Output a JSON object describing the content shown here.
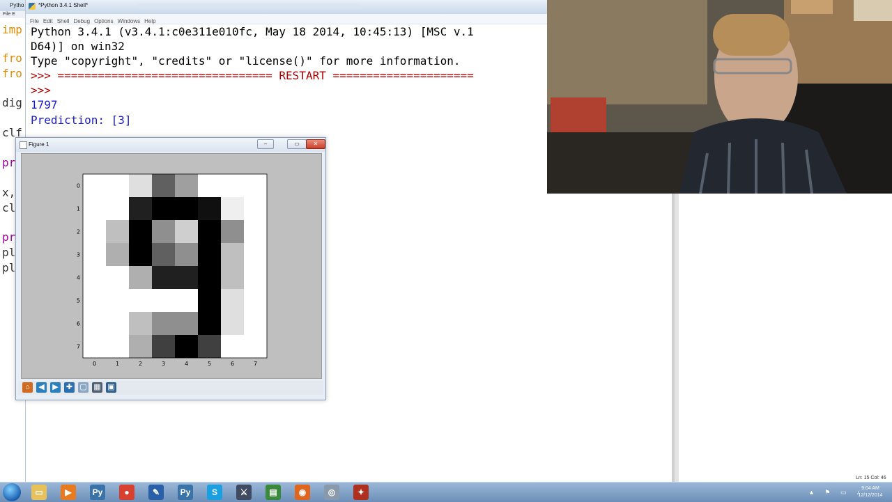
{
  "editor": {
    "title": "Pytho",
    "menu": "File E",
    "lines": [
      {
        "text": "imp",
        "cls": "kw-orange"
      },
      {
        "text": "fro",
        "cls": "kw-orange"
      },
      {
        "text": "fro",
        "cls": "kw-orange"
      },
      {
        "text": "dig",
        "cls": "kw-black"
      },
      {
        "text": "clf",
        "cls": "kw-black"
      },
      {
        "text": "pri",
        "cls": "kw-purple"
      },
      {
        "text": "x,",
        "cls": "kw-black"
      },
      {
        "text": "cl",
        "cls": "kw-black"
      },
      {
        "text": "pri",
        "cls": "kw-purple"
      },
      {
        "text": "pl",
        "cls": "kw-black"
      },
      {
        "text": "pl",
        "cls": "kw-black"
      }
    ]
  },
  "shell": {
    "title": "*Python 3.4.1 Shell*",
    "menu": [
      "File",
      "Edit",
      "Shell",
      "Debug",
      "Options",
      "Windows",
      "Help"
    ],
    "lines": [
      {
        "text": "Python 3.4.1 (v3.4.1:c0e311e010fc, May 18 2014, 10:45:13) [MSC v.1",
        "cls": ""
      },
      {
        "text": "D64)] on win32",
        "cls": ""
      },
      {
        "text": "Type \"copyright\", \"credits\" or \"license()\" for more information.",
        "cls": ""
      },
      {
        "text": ">>> ================================ RESTART =====================",
        "cls": "prompt"
      },
      {
        "text": ">>>",
        "cls": "prompt"
      },
      {
        "text": "1797",
        "cls": "out"
      },
      {
        "text": "Prediction: [3]",
        "cls": "out"
      }
    ],
    "status": "Ln: 15 Col: 46"
  },
  "figure": {
    "title": "Figure 1",
    "buttons": {
      "minimize": "–",
      "maximize": "▭",
      "close": "✕"
    },
    "toolbar": [
      {
        "icon": "home-icon",
        "glyph": "⌂",
        "color": "#d2691e"
      },
      {
        "icon": "back-icon",
        "glyph": "◀",
        "color": "#2a7fbf"
      },
      {
        "icon": "forward-icon",
        "glyph": "▶",
        "color": "#2a7fbf"
      },
      {
        "icon": "pan-icon",
        "glyph": "✚",
        "color": "#2a6fb0"
      },
      {
        "icon": "zoom-icon",
        "glyph": "▢",
        "color": "#8aa6c2"
      },
      {
        "icon": "configure-icon",
        "glyph": "▦",
        "color": "#4f5f72"
      },
      {
        "icon": "save-icon",
        "glyph": "▣",
        "color": "#2d5f8f"
      }
    ]
  },
  "chart_data": {
    "type": "heatmap",
    "xticks": [
      "0",
      "1",
      "2",
      "3",
      "4",
      "5",
      "6",
      "7"
    ],
    "yticks": [
      "0",
      "1",
      "2",
      "3",
      "4",
      "5",
      "6",
      "7"
    ],
    "colormap": "gray_r",
    "values": [
      [
        0,
        0,
        2,
        10,
        6,
        0,
        0,
        0
      ],
      [
        0,
        0,
        14,
        16,
        16,
        15,
        1,
        0
      ],
      [
        0,
        4,
        16,
        7,
        3,
        16,
        7,
        0
      ],
      [
        0,
        5,
        16,
        10,
        7,
        16,
        4,
        0
      ],
      [
        0,
        0,
        5,
        14,
        14,
        16,
        4,
        0
      ],
      [
        0,
        0,
        0,
        0,
        0,
        16,
        2,
        0
      ],
      [
        0,
        0,
        4,
        7,
        7,
        16,
        2,
        0
      ],
      [
        0,
        0,
        5,
        12,
        16,
        12,
        0,
        0
      ]
    ],
    "vmax": 16
  },
  "taskbar": {
    "icons": [
      {
        "name": "file-explorer-icon",
        "glyph": "▭",
        "color": "#e8c15a"
      },
      {
        "name": "media-player-icon",
        "glyph": "▶",
        "color": "#e87a20"
      },
      {
        "name": "python-icon",
        "glyph": "Py",
        "color": "#3a73a8"
      },
      {
        "name": "chrome-icon",
        "glyph": "●",
        "color": "#d8402f"
      },
      {
        "name": "pen-tool-icon",
        "glyph": "✎",
        "color": "#2a60a8"
      },
      {
        "name": "python-idle-icon",
        "glyph": "Py",
        "color": "#3a73a8"
      },
      {
        "name": "skype-icon",
        "glyph": "S",
        "color": "#1aa0e0"
      },
      {
        "name": "editor-icon",
        "glyph": "⚔",
        "color": "#404a60"
      },
      {
        "name": "terminal-icon",
        "glyph": "▤",
        "color": "#3a8a3a"
      },
      {
        "name": "firefox-icon",
        "glyph": "◉",
        "color": "#e0661f"
      },
      {
        "name": "webcam-icon",
        "glyph": "◎",
        "color": "#8a9aaa"
      },
      {
        "name": "game-icon",
        "glyph": "✦",
        "color": "#b03020"
      }
    ],
    "clock_time": "9:04 AM",
    "clock_date": "12/12/2014"
  }
}
